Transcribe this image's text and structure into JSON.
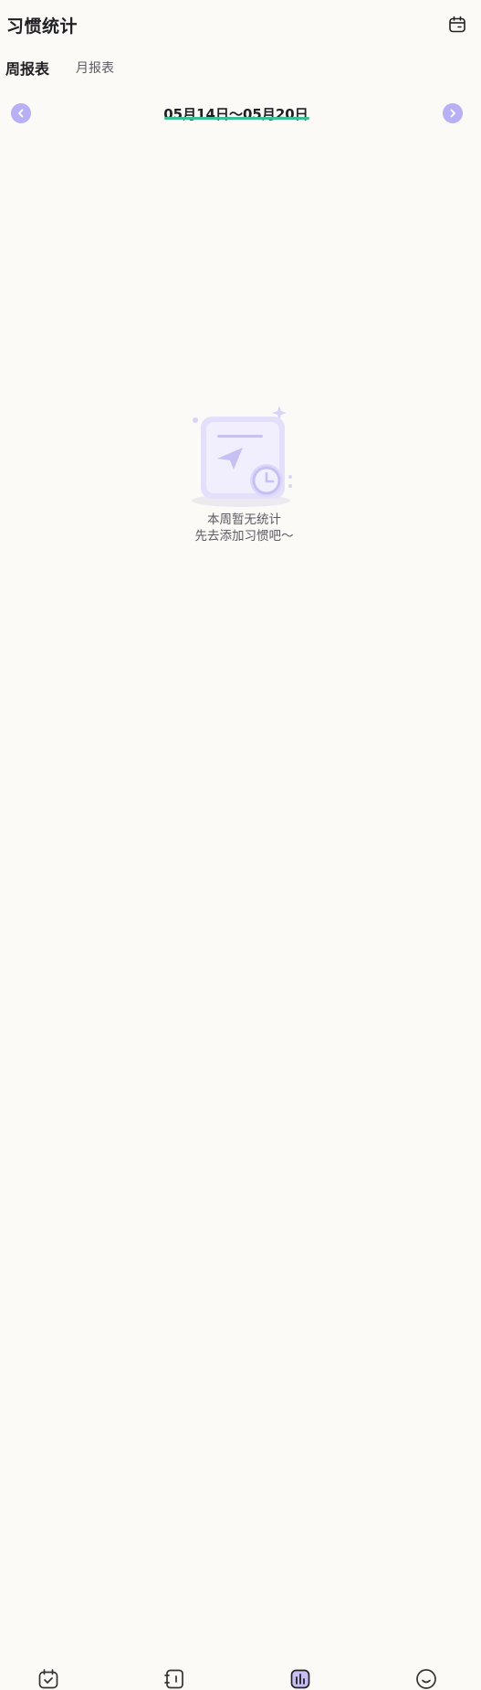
{
  "header": {
    "title": "习惯统计",
    "calendar_icon": "calendar-icon"
  },
  "tabs": [
    {
      "label": "周报表",
      "active": true
    },
    {
      "label": "月报表",
      "active": false
    }
  ],
  "range": {
    "text": "05月14日～05月20日",
    "prev_icon": "chevron-left-icon",
    "next_icon": "chevron-right-icon"
  },
  "empty_state": {
    "line1": "本周暂无统计",
    "line2": "先去添加习惯吧～",
    "illustration_icon": "empty-report-illustration-icon"
  },
  "bottom_nav": {
    "items": [
      {
        "name": "today",
        "icon": "calendar-check-icon",
        "active": false
      },
      {
        "name": "notebook",
        "icon": "notebook-icon",
        "active": false
      },
      {
        "name": "statistics",
        "icon": "bar-chart-icon",
        "active": true
      },
      {
        "name": "me",
        "icon": "smile-icon",
        "active": false
      }
    ]
  },
  "colors": {
    "background": "#fbfaf6",
    "accent_purple": "#b7b0f4",
    "accent_green": "#3cbf92",
    "text_primary": "#1f1f24",
    "text_secondary": "#5b5b63"
  }
}
